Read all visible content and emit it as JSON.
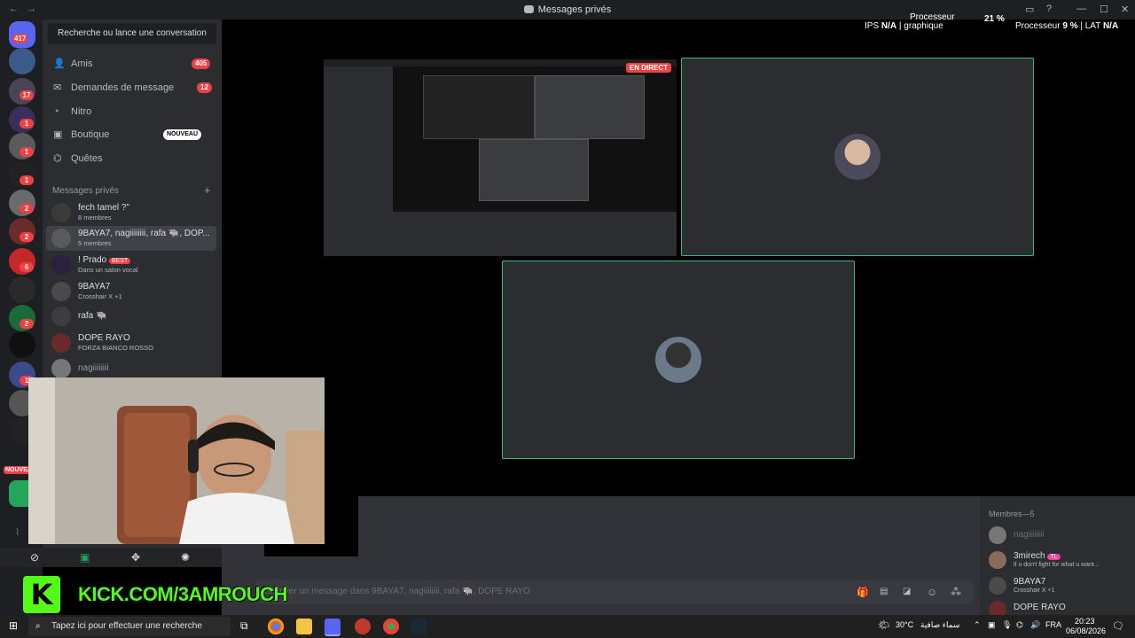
{
  "window": {
    "title": "Messages privés",
    "back": "←",
    "forward": "→"
  },
  "overlay": {
    "cpu_label_top": "Processeur",
    "fps_label": "IPS",
    "fps_value": "N/A",
    "gpu_label": "graphique",
    "cpu_pct_top": "21 %",
    "cpu_label": "Processeur",
    "cpu_value": "9 %",
    "lat_label": "LAT",
    "lat_value": "N/A"
  },
  "servers": {
    "badges": [
      "417",
      "17",
      "1",
      "1",
      "1",
      "2",
      "2",
      "6",
      "2",
      "1"
    ],
    "new_label": "NOUVEAU"
  },
  "sidebar": {
    "search": "Recherche ou lance une conversation",
    "nav": [
      {
        "label": "Amis",
        "icon": "friends-icon",
        "count": "405"
      },
      {
        "label": "Demandes de message",
        "icon": "mail-icon",
        "count": "12"
      },
      {
        "label": "Nitro",
        "icon": "nitro-icon"
      },
      {
        "label": "Boutique",
        "icon": "shop-icon",
        "tag": "NOUVEAU"
      },
      {
        "label": "Quêtes",
        "icon": "quests-icon"
      }
    ],
    "dm_header": "Messages privés",
    "dms": [
      {
        "name": "fech tamel ?\"",
        "sub": "8 membres"
      },
      {
        "name": "9BAYA7, nagiiiiiiii, rafa 🐃, DOP...",
        "sub": "5 membres"
      },
      {
        "name": "! Prado",
        "tag": "BEST",
        "sub": "Dans un salon vocal"
      },
      {
        "name": "9BAYA7",
        "sub": "Crosshair X +1"
      },
      {
        "name": "rafa 🐃",
        "sub": ""
      },
      {
        "name": "DOPE RAYO",
        "sub": "FORZA BIANCO ROSSO"
      },
      {
        "name": "nagiiiiiiii",
        "sub": ""
      }
    ]
  },
  "stage": {
    "live_badge": "EN DIRECT"
  },
  "chat": {
    "placeholder": "Envoyer un message dans 9BAYA7, nagiiiiiiii, rafa 🐃, DOPE RAYO"
  },
  "members": {
    "header": "Membres—5",
    "list": [
      {
        "name": "nagiiiiiiii",
        "sub": ""
      },
      {
        "name": "3mirech",
        "tag": "TL",
        "sub": "if u don't fight for what u want..."
      },
      {
        "name": "9BAYA7",
        "sub": "Crosshair X +1"
      },
      {
        "name": "DOPE RAYO",
        "sub": ""
      }
    ]
  },
  "kick": {
    "logo": "K",
    "url": "KICK.COM/3AMROUCH"
  },
  "taskbar": {
    "search": "Tapez ici pour effectuer une recherche",
    "temp": "30°C",
    "weather": "سماء صافية",
    "lang": "FRA",
    "time": "20:23",
    "date": "06/08/2026"
  },
  "colors": {
    "green": "#43b581",
    "kick_green": "#53fc18",
    "red": "#f23f43"
  }
}
